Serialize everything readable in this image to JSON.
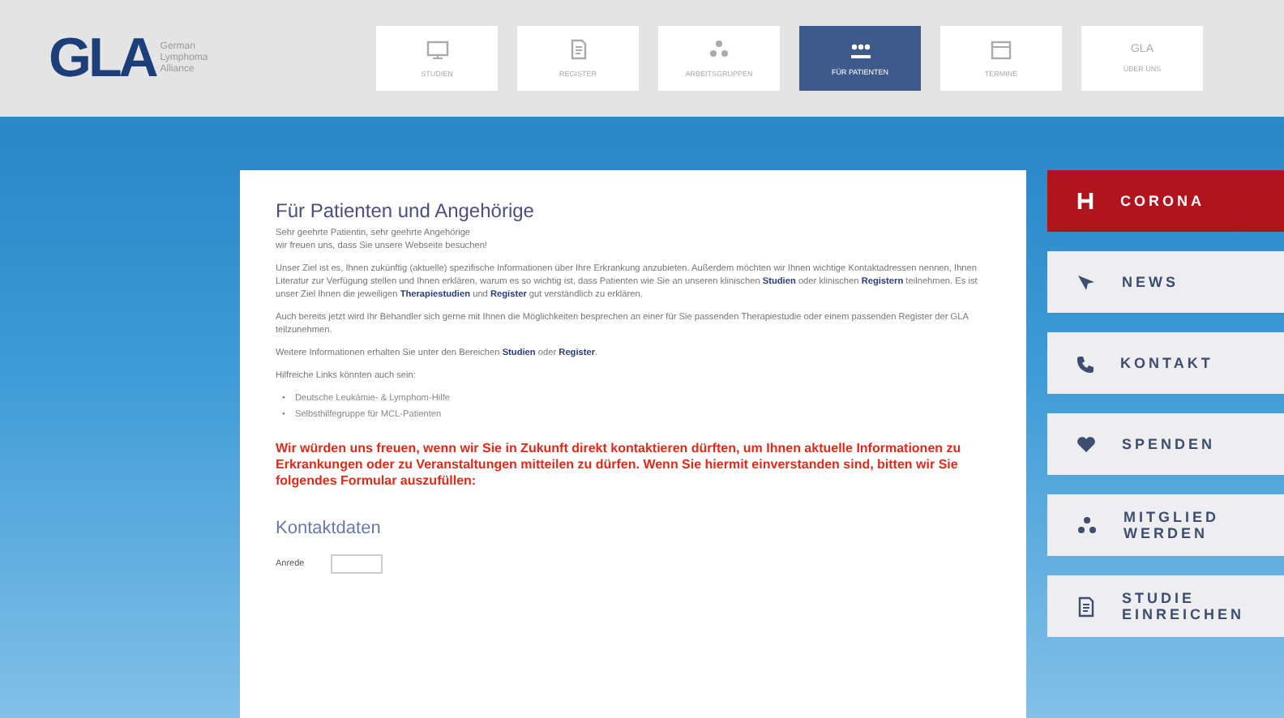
{
  "logo": {
    "mark": "GLA",
    "tagline": [
      "German",
      "Lymphoma",
      "Alliance"
    ]
  },
  "nav": [
    {
      "label": "STUDIEN",
      "selected": false
    },
    {
      "label": "REGISTER",
      "selected": false
    },
    {
      "label": "ARBEITSGRUPPEN",
      "selected": false
    },
    {
      "label": "FÜR PATIENTEN",
      "selected": true
    },
    {
      "label": "TERMINE",
      "selected": false
    },
    {
      "label": "ÜBER UNS",
      "icon_text": "GLA",
      "selected": false
    }
  ],
  "content": {
    "title": "Für Patienten und Angehörige",
    "greeting": [
      "Sehr geehrte Patientin, sehr geehrte Angehörige",
      "wir freuen uns, dass Sie unsere Webseite besuchen!"
    ],
    "paragraphs": [
      "Unser Ziel ist es, Ihnen zukünftig (aktuelle) spezifische Informationen über Ihre Erkrankung anzubieten. Außerdem möchten wir Ihnen wichtige Kontaktadressen nennen, Ihnen Literatur zur Verfügung stellen und Ihnen erklären, warum es so wichtig ist, dass Patienten wie Sie an unseren klinischen **Studien** oder klinischen **Registern** teilnehmen. Es ist unser Ziel Ihnen die jeweiligen **Therapiestudien** und **Register** gut verständlich zu erklären.",
      "Auch bereits jetzt wird Ihr Behandler sich gerne mit Ihnen die Möglichkeiten besprechen an einer für Sie passenden Therapiestudie oder einem passenden Register der GLA teilzunehmen.",
      "Weitere Informationen erhalten Sie unter den Bereichen **Studien** oder **Register**.",
      "Hilfreiche Links könnten auch sein:"
    ],
    "links": [
      {
        "marker": "•",
        "text": "Deutsche Leukämie- & Lymphom-Hilfe"
      },
      {
        "marker": "•",
        "text": "Selbsthilfegruppe für MCL-Patienten"
      }
    ],
    "notice": "Wir würden uns freuen, wenn wir Sie in Zukunft direkt kontaktieren dürften, um Ihnen aktuelle Informationen zu Erkrankungen oder zu Veranstaltungen mitteilen zu dürfen. Wenn Sie hiermit einverstanden sind, bitten wir Sie folgendes Formular auszufüllen:",
    "form_title": "Kontaktdaten",
    "field_label": "Anrede"
  },
  "side": [
    {
      "label": "CORONA",
      "kind": "alert"
    },
    {
      "label": "NEWS",
      "kind": "normal"
    },
    {
      "label": "KONTAKT",
      "kind": "normal"
    },
    {
      "label": "SPENDEN",
      "kind": "normal"
    },
    {
      "label": "MITGLIED WERDEN",
      "kind": "normal"
    },
    {
      "label": "STUDIE EINREICHEN",
      "kind": "normal"
    }
  ]
}
